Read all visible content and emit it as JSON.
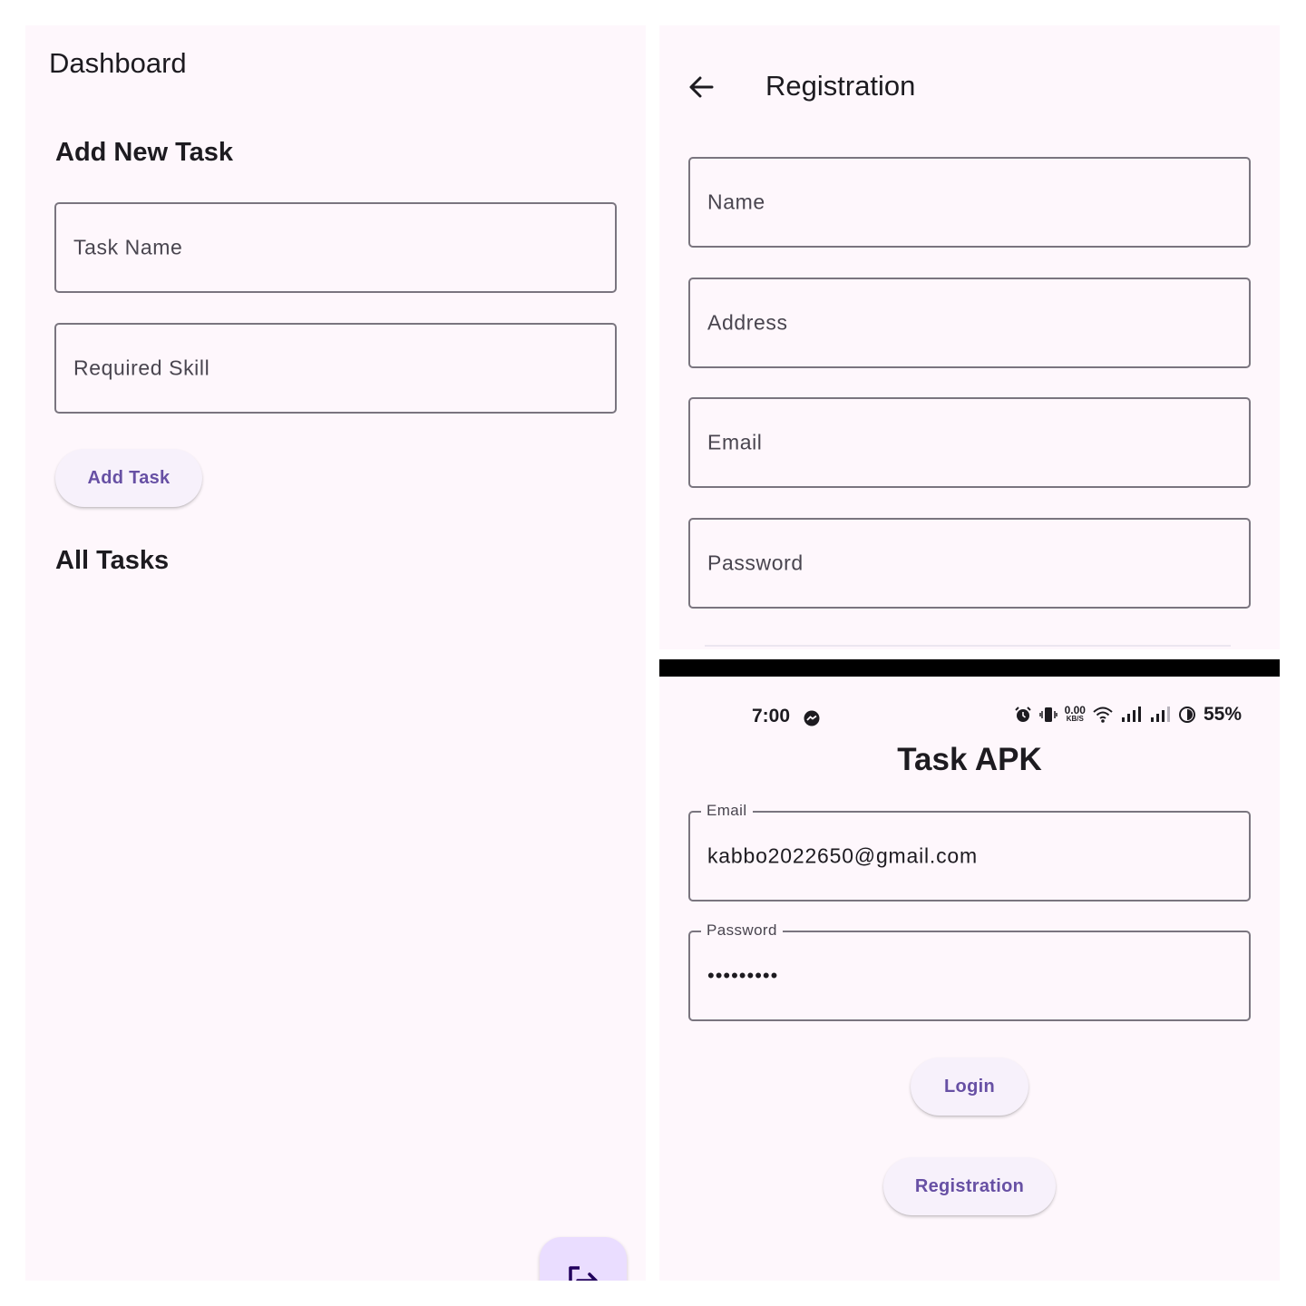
{
  "dashboard": {
    "title": "Dashboard",
    "add_section_title": "Add New Task",
    "task_name_placeholder": "Task Name",
    "required_skill_placeholder": "Required Skill",
    "add_task_button": "Add Task",
    "all_tasks_title": "All Tasks",
    "fab_icon": "logout-icon"
  },
  "registration": {
    "title": "Registration",
    "back_icon": "arrow-back-icon",
    "fields": [
      "Name",
      "Address",
      "Email",
      "Password"
    ]
  },
  "login": {
    "status_bar": {
      "time": "7:00",
      "data_rate_value": "0.00",
      "data_rate_unit": "KB/S",
      "battery": "55%",
      "icons": [
        "messenger-icon",
        "alarm-icon",
        "vibrate-icon",
        "wifi-icon",
        "signal-icon",
        "signal-icon",
        "battery-saver-icon"
      ]
    },
    "app_title": "Task APK",
    "email_label": "Email",
    "email_value": "kabbo2022650@gmail.com",
    "password_label": "Password",
    "password_value": "•••••••••",
    "login_button": "Login",
    "registration_button": "Registration"
  },
  "colors": {
    "background": "#fef7fc",
    "accent": "#6750a4",
    "button_fill": "#f7f1fb",
    "fab_fill": "#eaddff",
    "outline": "#7a757f"
  }
}
